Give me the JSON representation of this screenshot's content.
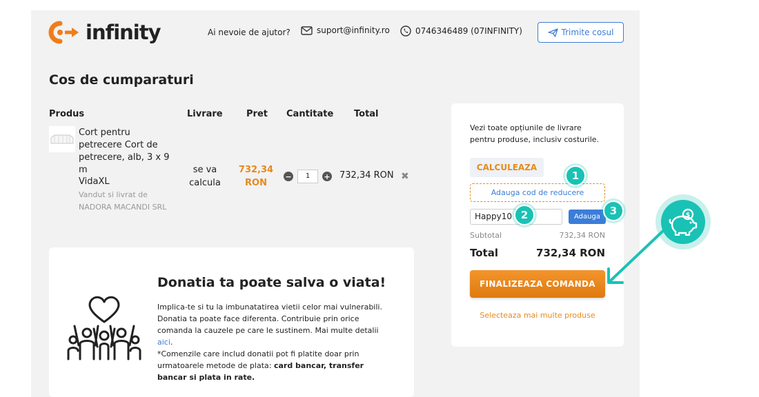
{
  "header": {
    "logo_text": "infinity",
    "help_text": "Ai nevoie de ajutor?",
    "email": "suport@infinity.ro",
    "phone": "0746346489 (07INFINITY)",
    "send_cart_label": "Trimite cosul"
  },
  "page_title": "Cos de cumparaturi",
  "table": {
    "columns": [
      "Produs",
      "Livrare",
      "Pret",
      "Cantitate",
      "Total"
    ]
  },
  "product": {
    "name": "Cort pentru petrecere Cort de petrecere, alb, 3 x 9 m",
    "brand": "VidaXL",
    "seller": "Vandut si livrat de NADORA MACANDI SRL",
    "delivery": "se va calcula",
    "price": "732,34 RON",
    "quantity": "1",
    "total": "732,34 RON",
    "remove_symbol": "✖"
  },
  "donation": {
    "title": "Donatia ta poate salva o viata!",
    "text_1": "Implica-te si tu la imbunatatirea vietii celor mai vulnerabili. Donatia ta poate face diferenta. Contribuie prin orice comanda la cauzele pe care le sustinem. Mai multe detalii ",
    "link": "aici",
    "text_2": ".",
    "text_3": "*Comenzile care includ donatii pot fi platite doar prin urmatoarele metode de plata: ",
    "bold": "card bancar, transfer bancar si plata in rate."
  },
  "summary": {
    "info": "Vezi toate opțiunile de livrare pentru produse, inclusiv costurile.",
    "calc_label": "CALCULEAZA",
    "coupon_link": "Adauga cod de reducere",
    "coupon_value": "Happy10",
    "add_label": "Adauga",
    "subtotal_label": "Subtotal",
    "subtotal_value": "732,34 RON",
    "total_label": "Total",
    "total_value": "732,34 RON",
    "finalize_label": "FINALIZEAZA COMANDA",
    "more_link": "Selecteaza mai multe produse"
  },
  "steps": [
    "1",
    "2",
    "3"
  ],
  "icons": {
    "logo": "infinity-logo-icon",
    "email": "envelope-icon",
    "phone": "phone-icon",
    "send": "paper-plane-icon",
    "piggy": "piggy-bank-icon",
    "donation": "heart-hands-icon"
  },
  "colors": {
    "accent_orange": "#e68a1d",
    "link_blue": "#3b7dd8",
    "teal_annotation": "#19c2b4"
  }
}
